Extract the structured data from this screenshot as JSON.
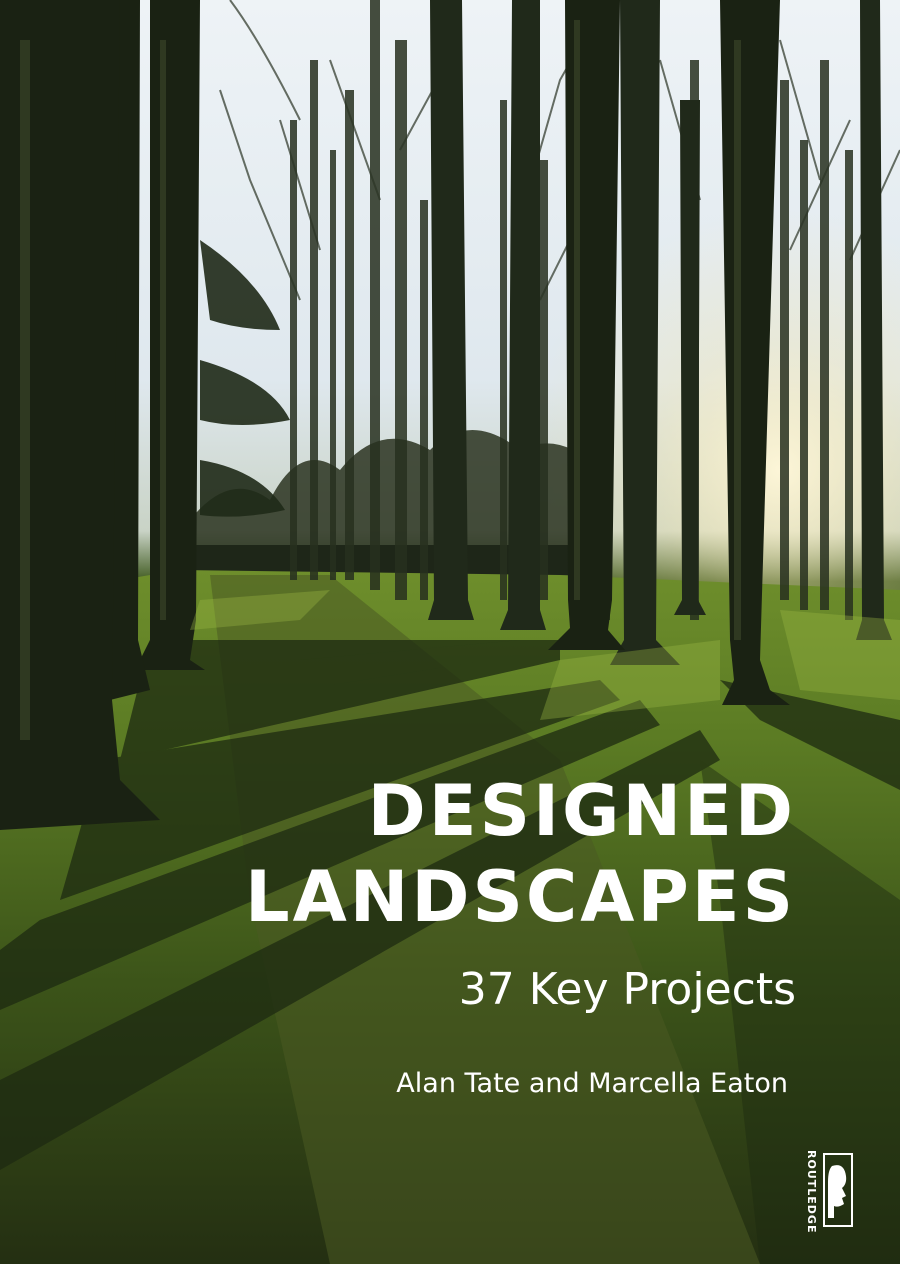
{
  "book": {
    "title_line1": "DESIGNED",
    "title_line2": "LANDSCAPES",
    "subtitle": "37 Key Projects",
    "authors": "Alan Tate and Marcella Eaton",
    "publisher": "ROUTLEDGE"
  },
  "colors": {
    "text": "#ffffff",
    "sky": "#eef3f6",
    "grass": "#4f6e22",
    "trunk": "#1c2415",
    "shadow": "#1d2a11"
  },
  "icons": {
    "publisher_logo": "routledge-head-logo-icon"
  }
}
